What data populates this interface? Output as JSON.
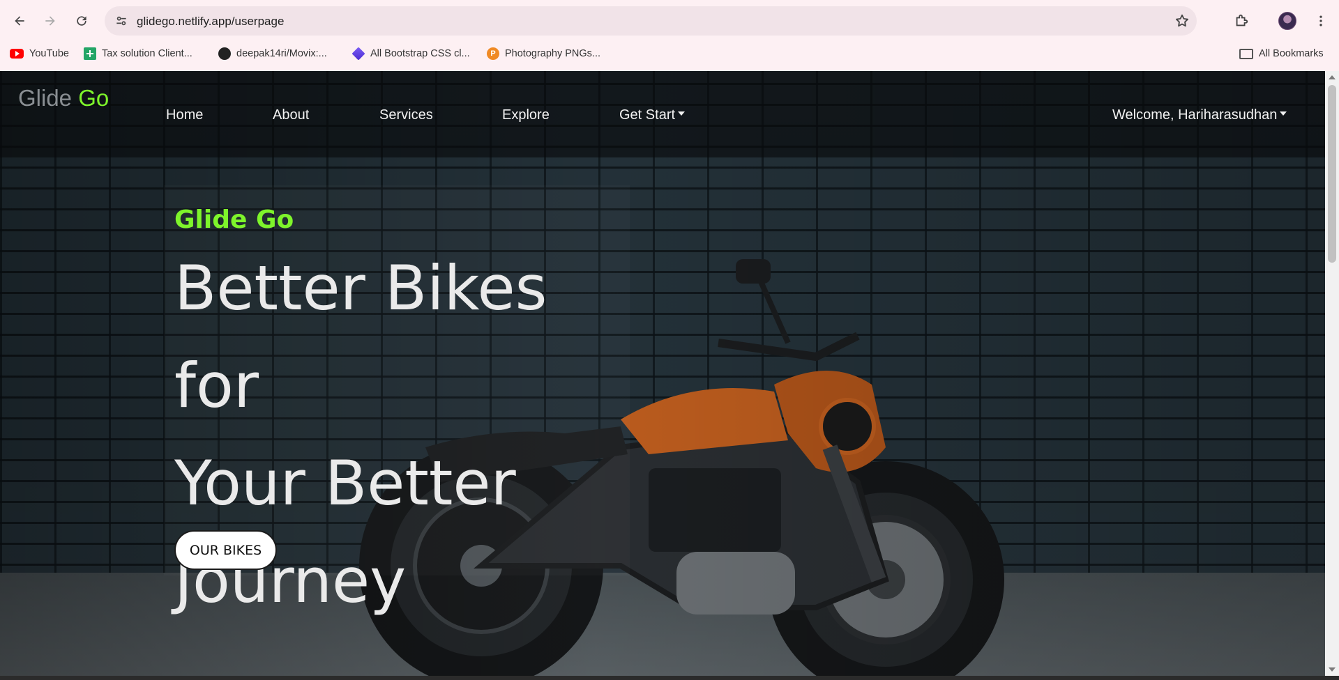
{
  "browser": {
    "url": "glidego.netlify.app/userpage",
    "bookmarks": [
      {
        "label": "YouTube",
        "icon": "youtube-icon"
      },
      {
        "label": "Tax solution Client...",
        "icon": "sheets-icon"
      },
      {
        "label": "deepak14ri/Movix:...",
        "icon": "github-icon"
      },
      {
        "label": "All Bootstrap CSS cl...",
        "icon": "bootstrap-icon"
      },
      {
        "label": "Photography PNGs...",
        "icon": "photography-icon"
      }
    ],
    "all_bookmarks_label": "All Bookmarks"
  },
  "navbar": {
    "brand_part1": "Glide",
    "brand_part2": "Go",
    "links": [
      "Home",
      "About",
      "Services",
      "Explore"
    ],
    "get_start": "Get Start",
    "welcome": "Welcome, Hariharasudhan"
  },
  "hero": {
    "tagline": "Glide Go",
    "title_lines": [
      "Better Bikes for",
      "Your Better",
      "Journey"
    ],
    "cta": "OUR BIKES"
  },
  "colors": {
    "accent_green": "#7ef52b",
    "bike_orange": "#c4601f"
  }
}
